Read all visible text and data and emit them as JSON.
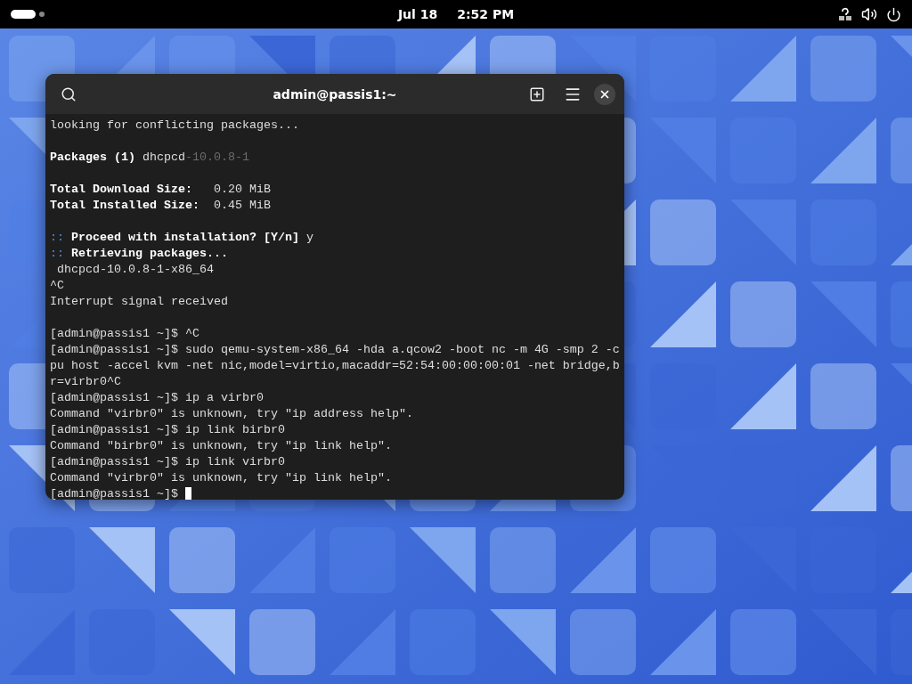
{
  "top_bar": {
    "date": "Jul 18",
    "time": "2:52 PM"
  },
  "terminal": {
    "title": "admin@passis1:~",
    "cursor_visible": true,
    "lines": [
      {
        "kind": "text",
        "segments": [
          {
            "kind": "plain",
            "text": "looking for conflicting packages..."
          }
        ]
      },
      {
        "kind": "blank"
      },
      {
        "kind": "text",
        "segments": [
          {
            "kind": "bold",
            "text": "Packages (1) "
          },
          {
            "kind": "plain",
            "text": "dhcpcd"
          },
          {
            "kind": "dim",
            "text": "-10.0.8-1"
          }
        ]
      },
      {
        "kind": "blank"
      },
      {
        "kind": "text",
        "segments": [
          {
            "kind": "bold",
            "text": "Total Download Size:"
          },
          {
            "kind": "plain",
            "text": "   0.20 MiB"
          }
        ]
      },
      {
        "kind": "text",
        "segments": [
          {
            "kind": "bold",
            "text": "Total Installed Size:"
          },
          {
            "kind": "plain",
            "text": "  0.45 MiB"
          }
        ]
      },
      {
        "kind": "blank"
      },
      {
        "kind": "text",
        "segments": [
          {
            "kind": "accent",
            "text": "::"
          },
          {
            "kind": "bold",
            "text": " Proceed with installation? [Y/n]"
          },
          {
            "kind": "plain",
            "text": " y"
          }
        ]
      },
      {
        "kind": "text",
        "segments": [
          {
            "kind": "accent",
            "text": "::"
          },
          {
            "kind": "bold",
            "text": " Retrieving packages..."
          }
        ]
      },
      {
        "kind": "text",
        "segments": [
          {
            "kind": "plain",
            "text": " dhcpcd-10.0.8-1-x86_64"
          }
        ]
      },
      {
        "kind": "text",
        "segments": [
          {
            "kind": "plain",
            "text": "^C"
          }
        ]
      },
      {
        "kind": "text",
        "segments": [
          {
            "kind": "plain",
            "text": "Interrupt signal received"
          }
        ]
      },
      {
        "kind": "blank"
      },
      {
        "kind": "text",
        "segments": [
          {
            "kind": "plain",
            "text": "[admin@passis1 ~]$ ^C"
          }
        ]
      },
      {
        "kind": "text",
        "segments": [
          {
            "kind": "plain",
            "text": "[admin@passis1 ~]$ sudo qemu-system-x86_64 -hda a.qcow2 -boot nc -m 4G -smp 2 -c"
          }
        ]
      },
      {
        "kind": "text",
        "segments": [
          {
            "kind": "plain",
            "text": "pu host -accel kvm -net nic,model=virtio,macaddr=52:54:00:00:00:01 -net bridge,b"
          }
        ]
      },
      {
        "kind": "text",
        "segments": [
          {
            "kind": "plain",
            "text": "r=virbr0^C"
          }
        ]
      },
      {
        "kind": "text",
        "segments": [
          {
            "kind": "plain",
            "text": "[admin@passis1 ~]$ ip a virbr0"
          }
        ]
      },
      {
        "kind": "text",
        "segments": [
          {
            "kind": "plain",
            "text": "Command \"virbr0\" is unknown, try \"ip address help\"."
          }
        ]
      },
      {
        "kind": "text",
        "segments": [
          {
            "kind": "plain",
            "text": "[admin@passis1 ~]$ ip link birbr0"
          }
        ]
      },
      {
        "kind": "text",
        "segments": [
          {
            "kind": "plain",
            "text": "Command \"birbr0\" is unknown, try \"ip link help\"."
          }
        ]
      },
      {
        "kind": "text",
        "segments": [
          {
            "kind": "plain",
            "text": "[admin@passis1 ~]$ ip link virbr0"
          }
        ]
      },
      {
        "kind": "text",
        "segments": [
          {
            "kind": "plain",
            "text": "Command \"virbr0\" is unknown, try \"ip link help\"."
          }
        ]
      },
      {
        "kind": "text",
        "segments": [
          {
            "kind": "plain",
            "text": "[admin@passis1 ~]$ "
          }
        ]
      }
    ]
  }
}
